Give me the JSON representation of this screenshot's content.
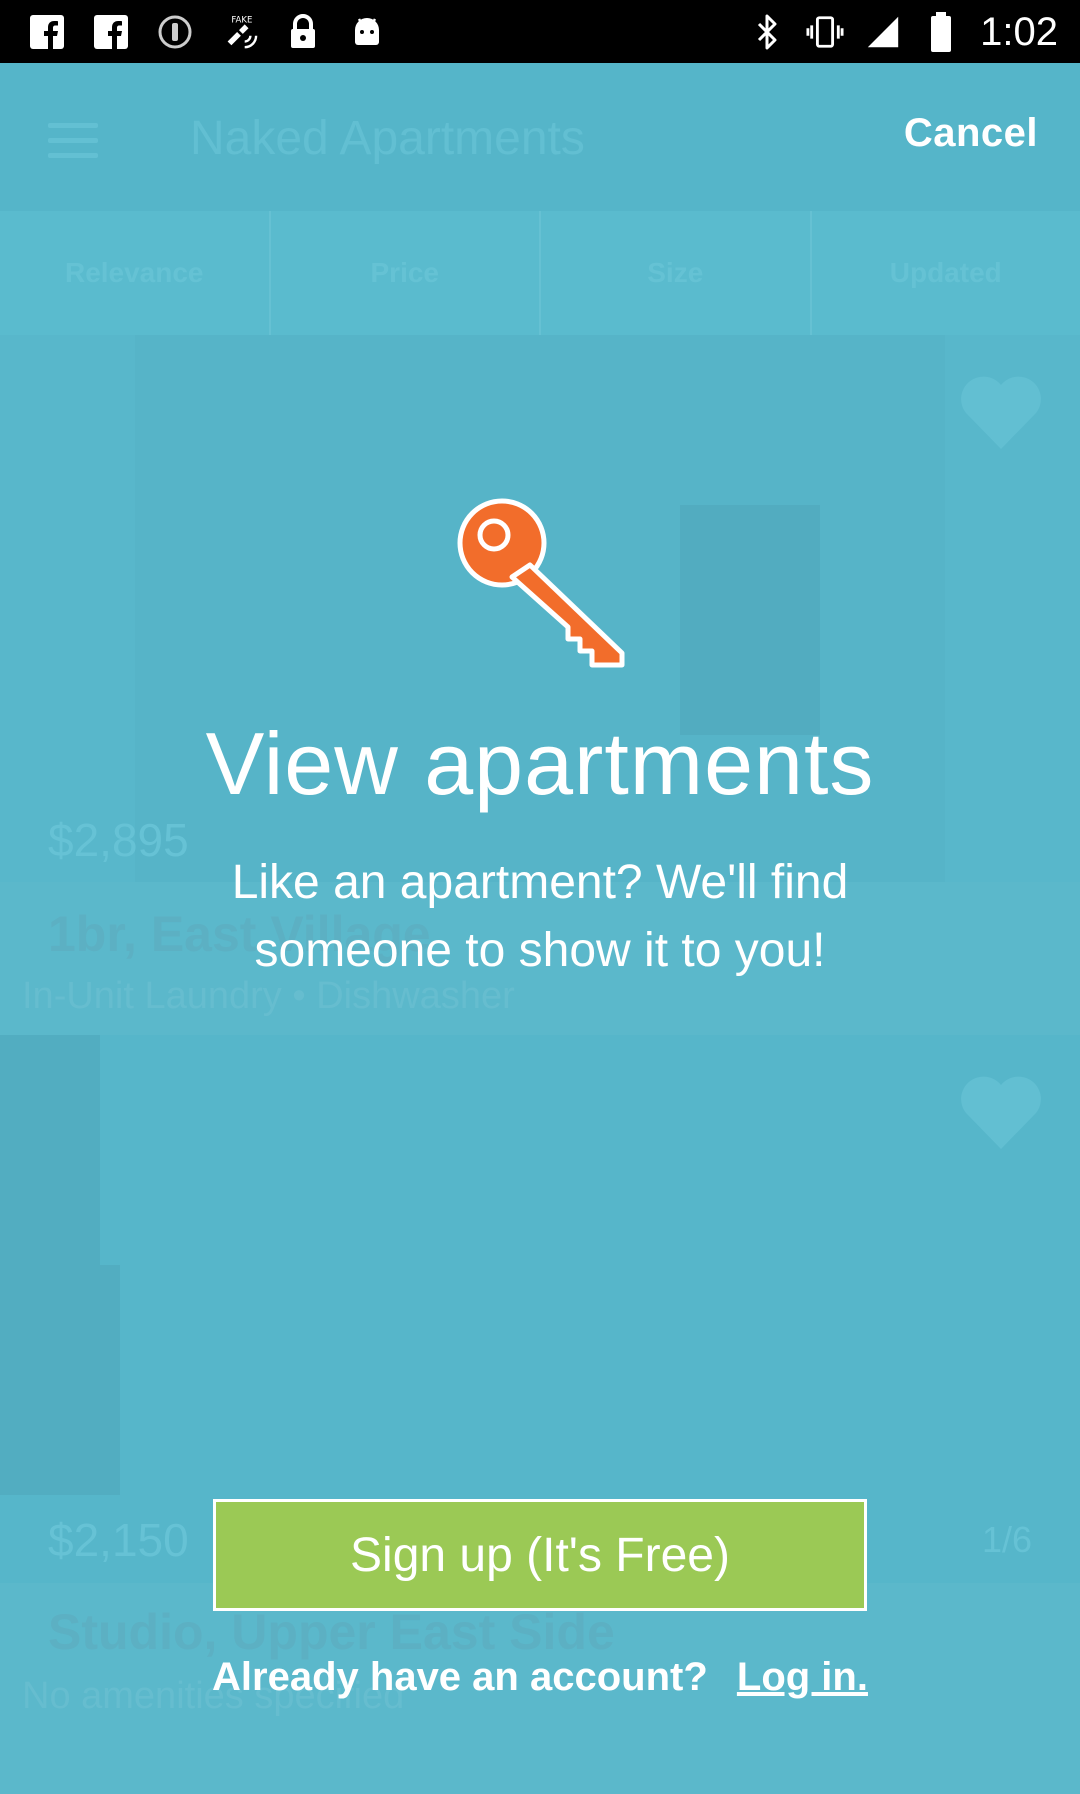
{
  "status_bar": {
    "left_icons": [
      "facebook-icon",
      "facebook-icon",
      "info-icon",
      "fake-gps-icon",
      "lock-icon",
      "android-icon"
    ],
    "right_icons": [
      "bluetooth-icon",
      "vibrate-icon",
      "signal-icon",
      "battery-icon"
    ],
    "time": "1:02"
  },
  "background_app": {
    "title": "Naked Apartments",
    "sort_tabs": [
      "Relevance",
      "Price",
      "Size",
      "Updated"
    ],
    "listings": [
      {
        "price": "$2,895",
        "title": "1br, East Village",
        "amenities": "In-Unit Laundry • Dishwasher",
        "pager": ""
      },
      {
        "price": "$2,150",
        "title": "Studio, Upper East Side",
        "amenities": "No amenities specified",
        "pager": "1/6"
      }
    ]
  },
  "modal": {
    "cancel_label": "Cancel",
    "icon": "key-icon",
    "headline": "View apartments",
    "subtext_line1": "Like an apartment? We'll find",
    "subtext_line2": "someone to show it to you!",
    "signup_label": "Sign up (It's Free)",
    "login_prompt": "Already have an account?",
    "login_link": "Log in."
  },
  "colors": {
    "overlay": "#5bb8cb",
    "key": "#f26d2b",
    "signup_button": "#9bc955",
    "text": "#ffffff"
  }
}
